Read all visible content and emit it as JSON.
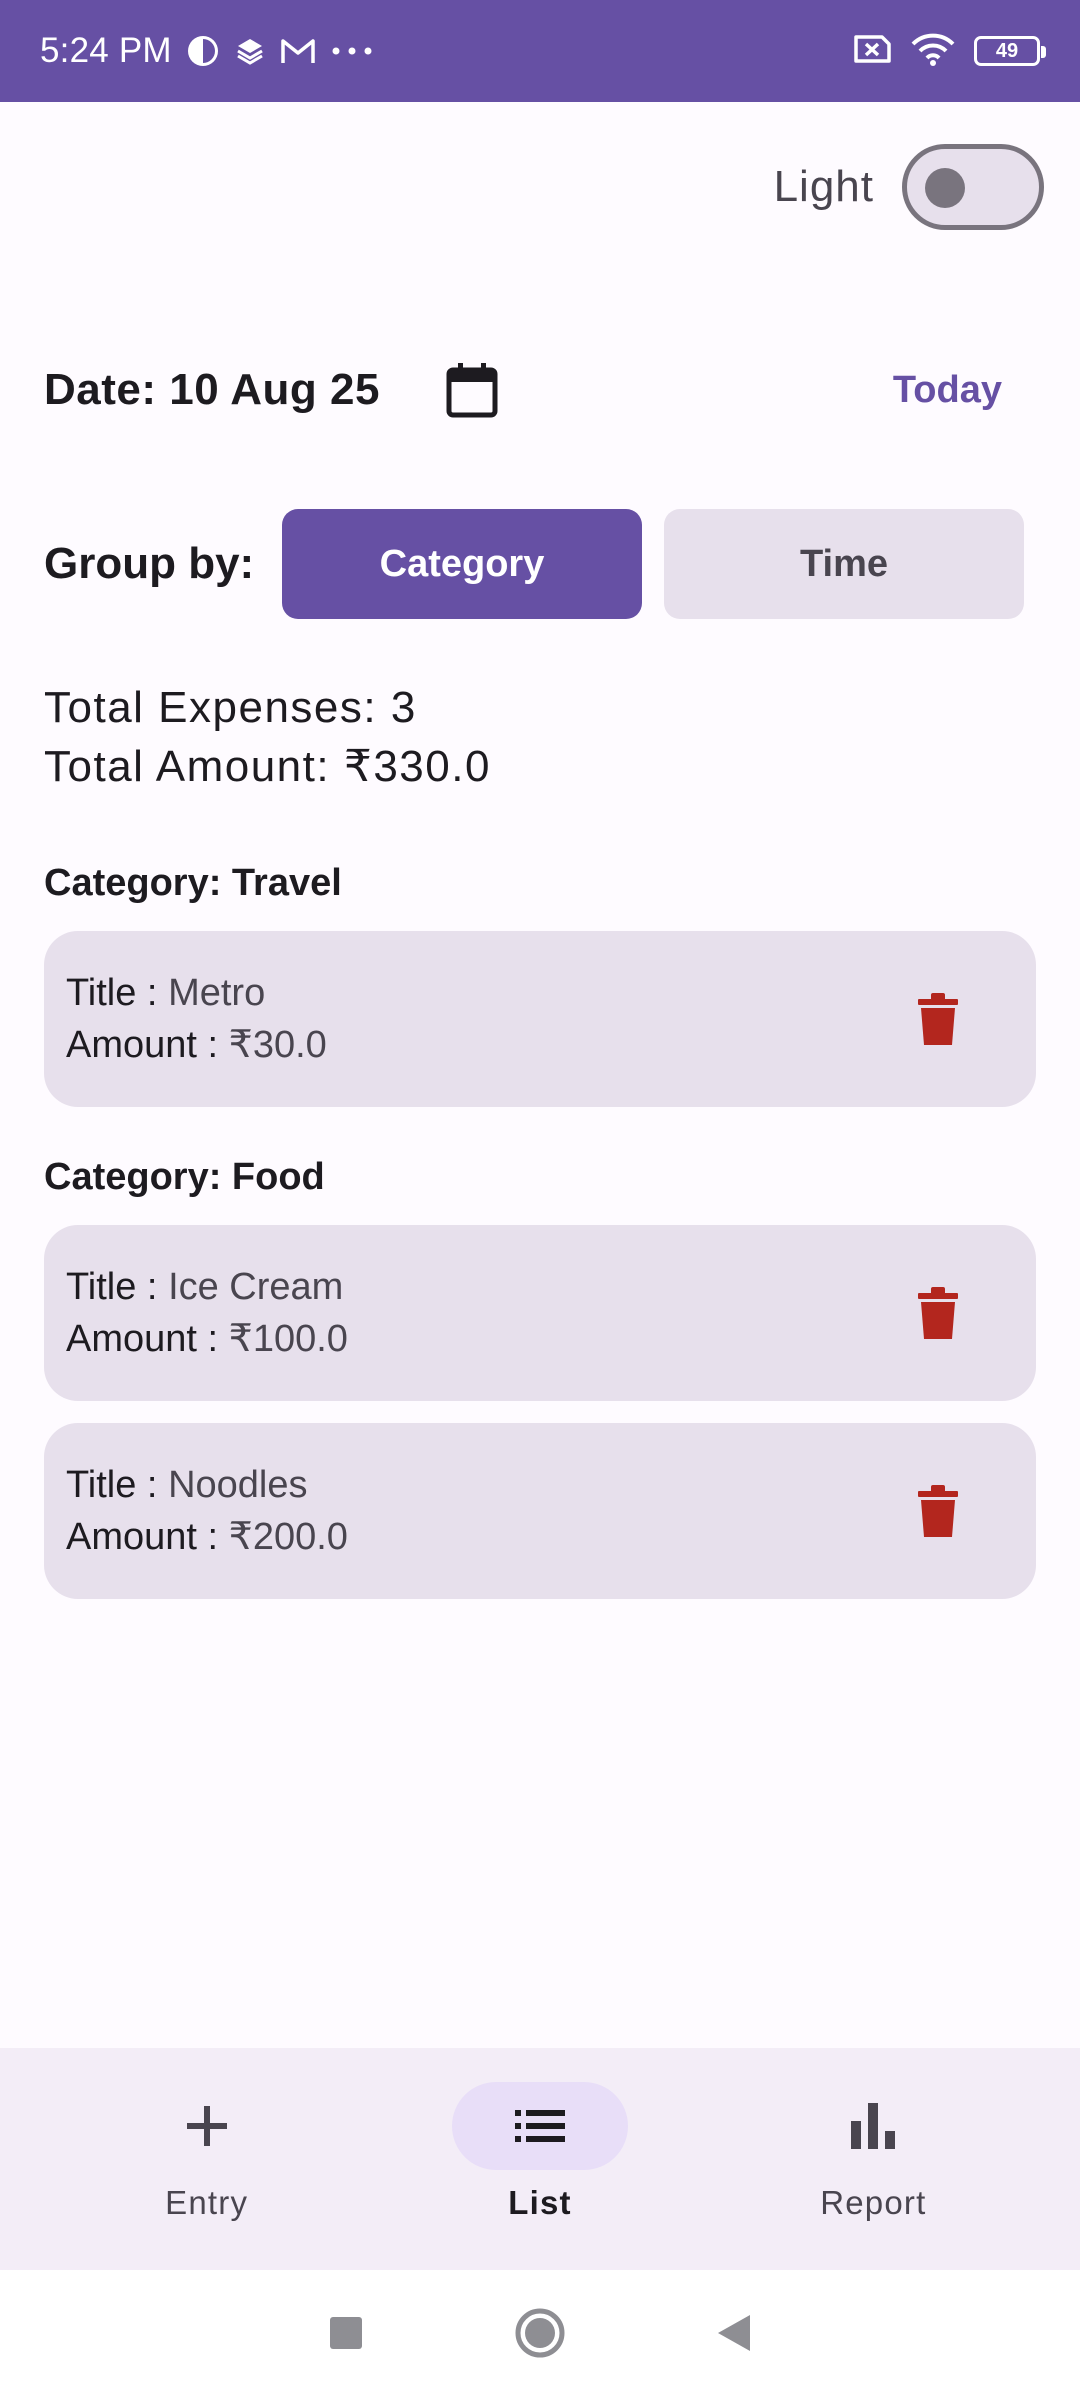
{
  "status_bar": {
    "time": "5:24 PM",
    "battery": "49",
    "icons": [
      "pie-icon",
      "layers-icon",
      "gmail-icon",
      "more-dots-icon",
      "sim-x-icon",
      "wifi-icon",
      "battery-icon"
    ]
  },
  "theme": {
    "label": "Light",
    "enabled": false
  },
  "date_row": {
    "date_label": "Date: 10 Aug 25",
    "today_label": "Today"
  },
  "group_by": {
    "label": "Group by:",
    "options": [
      "Category",
      "Time"
    ],
    "selected": "Category"
  },
  "totals": {
    "expenses": "Total Expenses: 3",
    "amount": "Total Amount: ₹330.0"
  },
  "groups": [
    {
      "header": "Category: Travel",
      "items": [
        {
          "title_label": "Title : ",
          "title": "Metro",
          "amount_label": "Amount : ",
          "amount": "₹30.0"
        }
      ]
    },
    {
      "header": "Category: Food",
      "items": [
        {
          "title_label": "Title : ",
          "title": "Ice Cream",
          "amount_label": "Amount : ",
          "amount": "₹100.0"
        },
        {
          "title_label": "Title : ",
          "title": "Noodles",
          "amount_label": "Amount : ",
          "amount": "₹200.0"
        }
      ]
    }
  ],
  "bottom_nav": {
    "items": [
      {
        "label": "Entry",
        "icon": "plus-icon"
      },
      {
        "label": "List",
        "icon": "list-icon",
        "active": true
      },
      {
        "label": "Report",
        "icon": "bar-chart-icon"
      }
    ]
  },
  "colors": {
    "primary": "#6650a4",
    "surface_variant": "#e7e0ec",
    "delete": "#b3261e",
    "nav_background": "#f3edf7",
    "nav_indicator": "#e8def8"
  }
}
